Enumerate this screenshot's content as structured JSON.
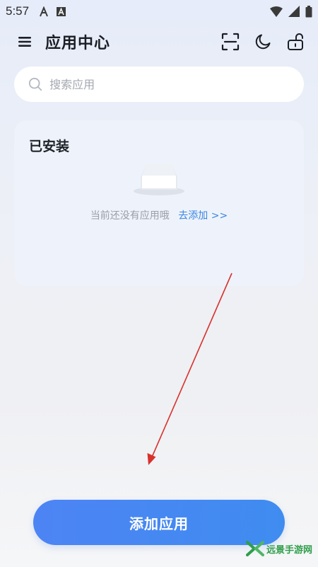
{
  "status_bar": {
    "time": "5:57",
    "icons": [
      "font-a-icon",
      "a-square-icon",
      "wifi-icon",
      "signal-icon",
      "battery-icon"
    ]
  },
  "app_bar": {
    "title": "应用中心",
    "actions": [
      "scan-icon",
      "moon-icon",
      "unlock-icon"
    ]
  },
  "search": {
    "placeholder": "搜索应用",
    "value": ""
  },
  "installed": {
    "title": "已安装",
    "empty_text": "当前还没有应用哦",
    "add_link": "去添加 >>"
  },
  "primary_button": {
    "label": "添加应用"
  },
  "watermark": {
    "text": "远景手游网"
  },
  "colors": {
    "accent": "#4a86f2",
    "link": "#3c86e0",
    "annotation_arrow": "#d9302c",
    "watermark": "#2e9e4a"
  }
}
